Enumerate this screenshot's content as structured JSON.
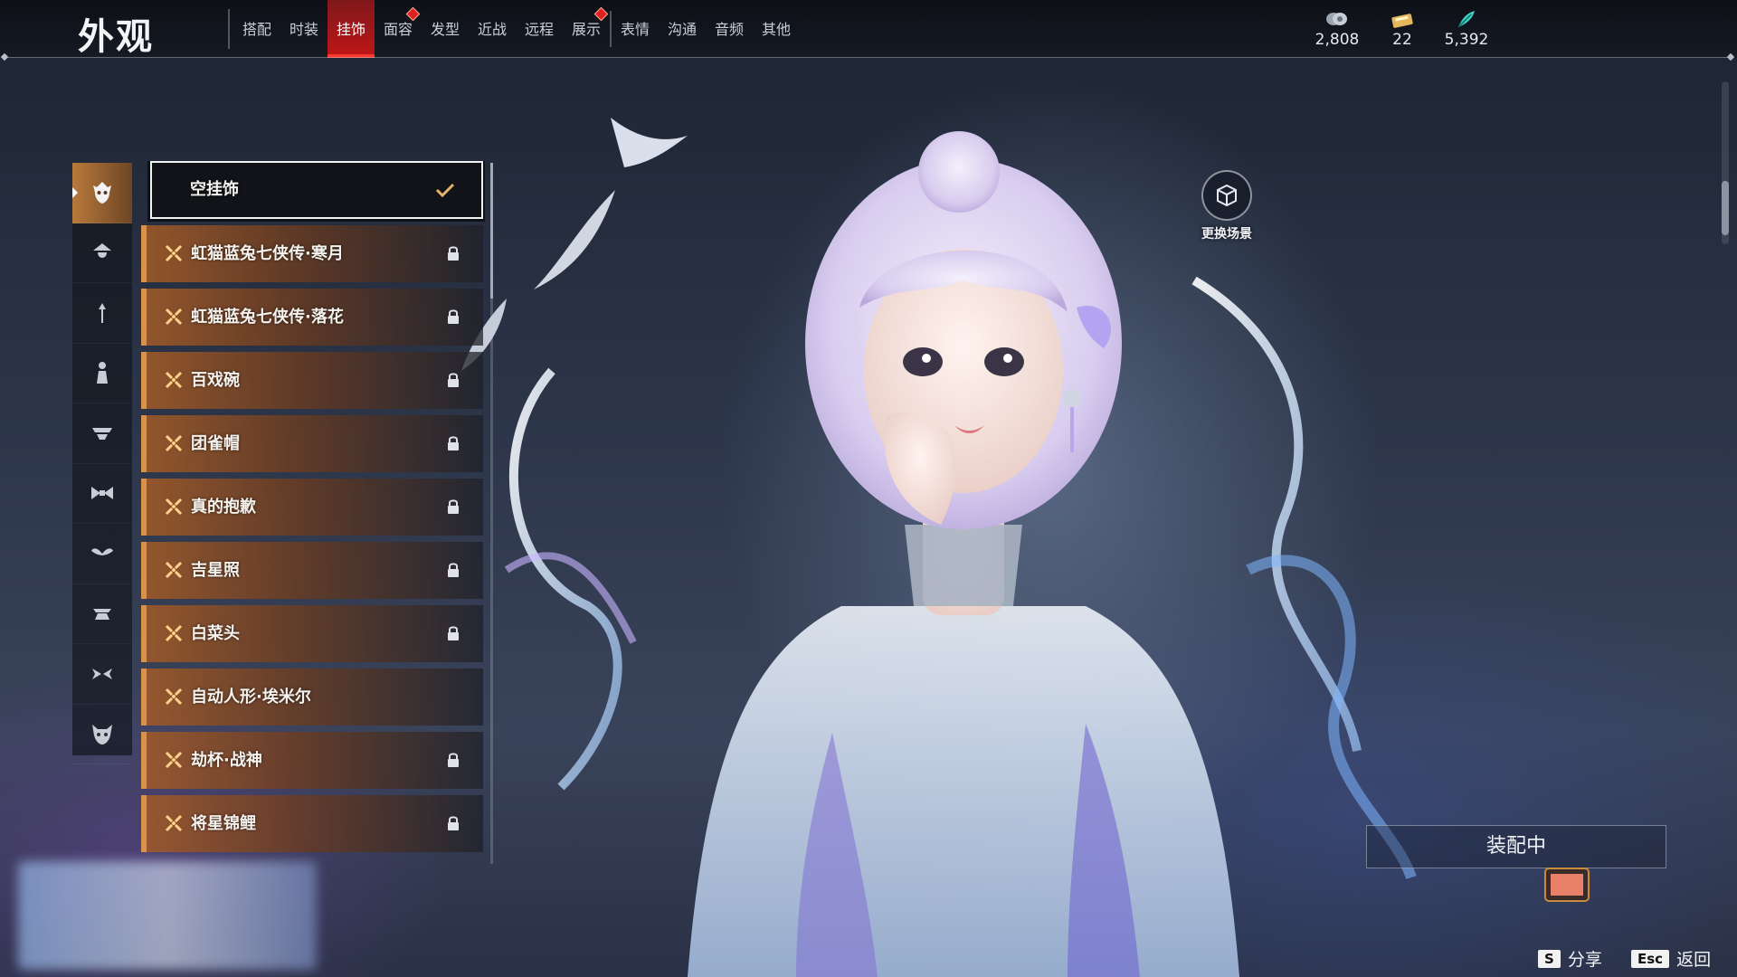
{
  "header": {
    "title": "外观",
    "tabs": [
      {
        "label": "搭配",
        "active": false,
        "badge": false
      },
      {
        "label": "时装",
        "active": false,
        "badge": false
      },
      {
        "label": "挂饰",
        "active": true,
        "badge": false
      },
      {
        "label": "面容",
        "active": false,
        "badge": true
      },
      {
        "label": "发型",
        "active": false,
        "badge": false
      },
      {
        "label": "近战",
        "active": false,
        "badge": false
      },
      {
        "label": "远程",
        "active": false,
        "badge": false
      },
      {
        "label": "展示",
        "active": false,
        "badge": true
      },
      {
        "label": "表情",
        "active": false,
        "badge": false
      },
      {
        "label": "沟通",
        "active": false,
        "badge": false
      },
      {
        "label": "音频",
        "active": false,
        "badge": false
      },
      {
        "label": "其他",
        "active": false,
        "badge": false
      }
    ],
    "currencies": [
      {
        "icon": "coin-stack-icon",
        "value": "2,808"
      },
      {
        "icon": "ticket-icon",
        "value": "22"
      },
      {
        "icon": "feather-icon",
        "value": "5,392"
      }
    ]
  },
  "categories": [
    {
      "icon": "mask-icon",
      "active": true
    },
    {
      "icon": "hat-icon",
      "active": false
    },
    {
      "icon": "hairpin-icon",
      "active": false
    },
    {
      "icon": "figure-icon",
      "active": false
    },
    {
      "icon": "cape-icon",
      "active": false
    },
    {
      "icon": "bow-icon",
      "active": false
    },
    {
      "icon": "wings-icon",
      "active": false
    },
    {
      "icon": "skirt-icon",
      "active": false
    },
    {
      "icon": "ribbon-icon",
      "active": false
    },
    {
      "icon": "demon-mask-icon",
      "active": false
    }
  ],
  "items": [
    {
      "label": "空挂饰",
      "selected": true,
      "locked": false
    },
    {
      "label": "虹猫蓝兔七侠传·寒月",
      "selected": false,
      "locked": true
    },
    {
      "label": "虹猫蓝兔七侠传·落花",
      "selected": false,
      "locked": true
    },
    {
      "label": "百戏碗",
      "selected": false,
      "locked": true
    },
    {
      "label": "团雀帽",
      "selected": false,
      "locked": true
    },
    {
      "label": "真的抱歉",
      "selected": false,
      "locked": true
    },
    {
      "label": "吉星照",
      "selected": false,
      "locked": true
    },
    {
      "label": "白菜头",
      "selected": false,
      "locked": true
    },
    {
      "label": "自动人形·埃米尔",
      "selected": false,
      "locked": false
    },
    {
      "label": "劫杯·战神",
      "selected": false,
      "locked": true
    },
    {
      "label": "将星锦鲤",
      "selected": false,
      "locked": true
    }
  ],
  "scene": {
    "label": "更换场景"
  },
  "equip_status": "装配中",
  "hints": [
    {
      "key": "S",
      "label": "分享"
    },
    {
      "key": "Esc",
      "label": "返回"
    }
  ],
  "colors": {
    "accent_red": "#e02020",
    "item_orange": "#d9924a",
    "background": "#2b3447"
  }
}
